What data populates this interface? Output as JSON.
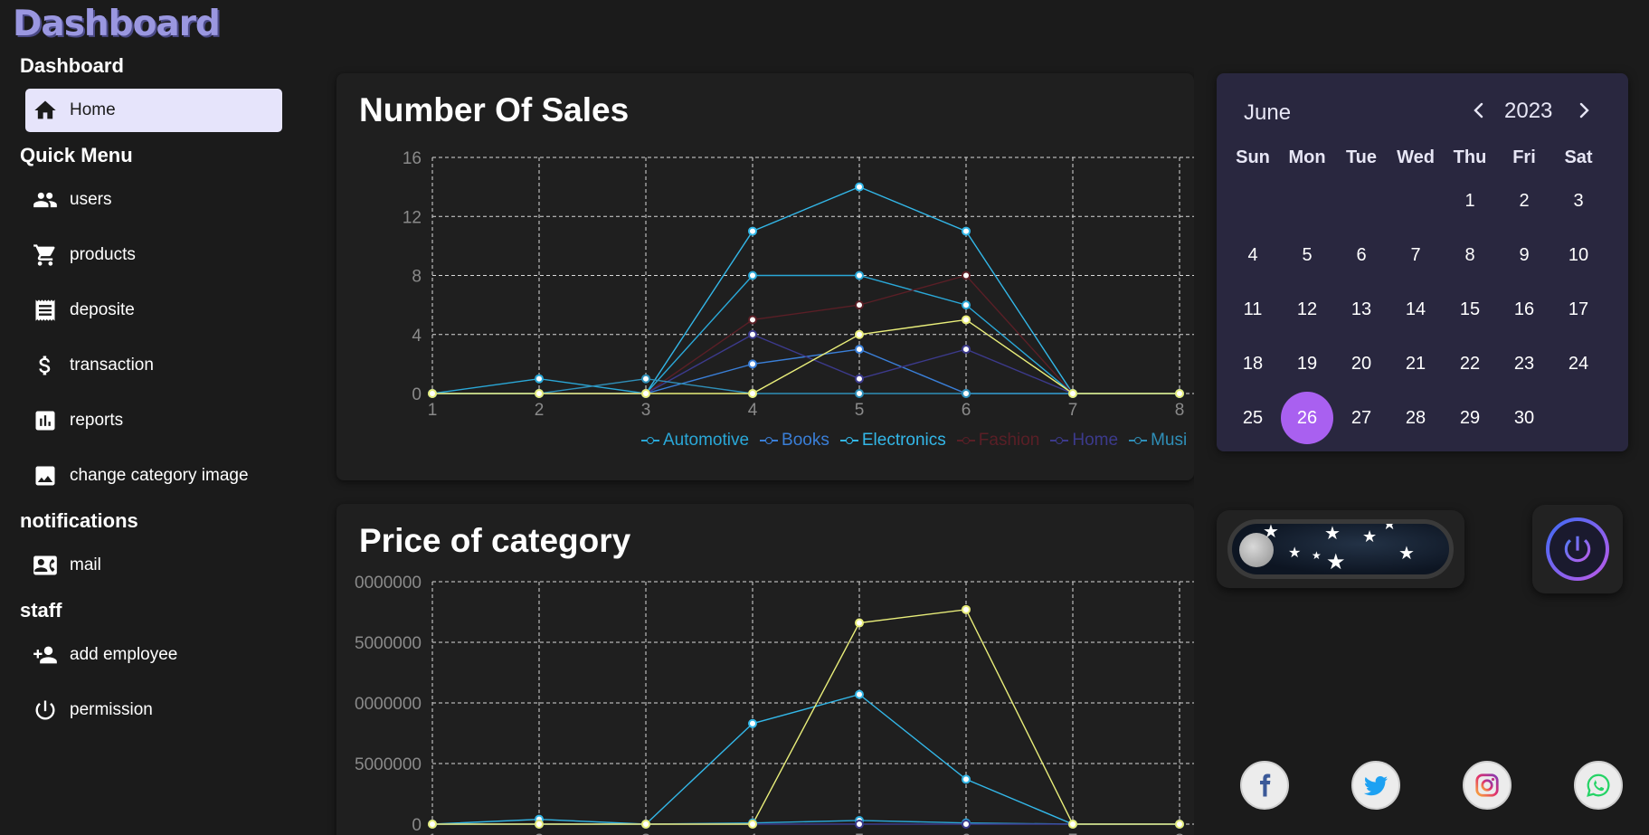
{
  "app": {
    "brand": "Dashboard"
  },
  "header": {
    "settings_icon": "gear-icon",
    "avatar_icon": "user-avatar"
  },
  "sidebar": {
    "sections": [
      {
        "title": "Dashboard",
        "items": [
          {
            "label": "Home",
            "icon": "home-icon",
            "active": true
          }
        ]
      },
      {
        "title": "Quick Menu",
        "items": [
          {
            "label": "users",
            "icon": "users-icon"
          },
          {
            "label": "products",
            "icon": "cart-icon"
          },
          {
            "label": "deposite",
            "icon": "receipt-icon"
          },
          {
            "label": "transaction",
            "icon": "dollar-icon"
          },
          {
            "label": "reports",
            "icon": "bar-chart-icon"
          },
          {
            "label": "change category image",
            "icon": "image-icon"
          }
        ]
      },
      {
        "title": "notifications",
        "items": [
          {
            "label": "mail",
            "icon": "contact-mail-icon"
          }
        ]
      },
      {
        "title": "staff",
        "items": [
          {
            "label": "add employee",
            "icon": "person-add-icon"
          },
          {
            "label": "permission",
            "icon": "power-icon"
          }
        ]
      }
    ]
  },
  "charts": {
    "sales_title": "Number Of Sales",
    "price_title": "Price of category"
  },
  "chart_data": [
    {
      "type": "line",
      "title": "Number Of Sales",
      "x": [
        1,
        2,
        3,
        4,
        5,
        6,
        7,
        8
      ],
      "ylim": [
        0,
        16
      ],
      "yticks": [
        0,
        4,
        8,
        12,
        16
      ],
      "grid": true,
      "legend_position": "bottom",
      "series": [
        {
          "name": "Automotive",
          "color": "#2aa8d8",
          "values": [
            0,
            1,
            0,
            8,
            8,
            6,
            0,
            0
          ]
        },
        {
          "name": "Books",
          "color": "#3a7fd8",
          "values": [
            0,
            0,
            0,
            2,
            3,
            0,
            0,
            0
          ]
        },
        {
          "name": "Electronics",
          "color": "#33b7e8",
          "values": [
            0,
            0,
            0,
            11,
            14,
            11,
            0,
            0
          ]
        },
        {
          "name": "Fashion",
          "color": "#5a1f26",
          "values": [
            0,
            0,
            0,
            5,
            6,
            8,
            0,
            0
          ]
        },
        {
          "name": "Home",
          "color": "#3c3a8c",
          "values": [
            0,
            0,
            0,
            4,
            1,
            3,
            0,
            0
          ]
        },
        {
          "name": "Musi",
          "color": "#2f8fb8",
          "values": [
            0,
            0,
            1,
            0,
            0,
            0,
            0,
            0
          ]
        },
        {
          "color": "#e9ee7a",
          "values": [
            0,
            0,
            0,
            0,
            4,
            5,
            0,
            0
          ]
        }
      ]
    },
    {
      "type": "line",
      "title": "Price of category",
      "x": [
        1,
        2,
        3,
        4,
        5,
        6,
        7,
        8
      ],
      "ylim": [
        0,
        20000000
      ],
      "yticks": [
        0,
        5000000,
        10000000,
        15000000,
        20000000
      ],
      "ytick_labels": [
        "0",
        "5000000",
        "0000000",
        "5000000",
        "0000000"
      ],
      "grid": true,
      "series": [
        {
          "color": "#33b7e8",
          "values": [
            0,
            400000,
            0,
            8300000,
            10700000,
            3700000,
            0,
            0
          ]
        },
        {
          "color": "#2aa8d8",
          "values": [
            0,
            0,
            0,
            100000,
            300000,
            100000,
            0,
            0
          ]
        },
        {
          "color": "#3c3a8c",
          "values": [
            0,
            0,
            0,
            0,
            0,
            0,
            0,
            0
          ]
        },
        {
          "color": "#e9ee7a",
          "values": [
            0,
            0,
            0,
            0,
            16600000,
            17700000,
            0,
            0
          ]
        }
      ]
    }
  ],
  "calendar": {
    "month": "June",
    "year": "2023",
    "today": 26,
    "first_weekday": 4,
    "days_in_month": 30,
    "weekdays": [
      "Sun",
      "Mon",
      "Tue",
      "Wed",
      "Thu",
      "Fri",
      "Sat"
    ],
    "prev_icon": "chevron-left-icon",
    "next_icon": "chevron-right-icon"
  },
  "toggles": {
    "theme_icon": "moon-icon",
    "power_icon": "power-icon"
  },
  "social": [
    {
      "name": "facebook",
      "icon": "facebook-icon",
      "color": "#3b5998"
    },
    {
      "name": "twitter",
      "icon": "twitter-icon",
      "color": "#1da1f2"
    },
    {
      "name": "instagram",
      "icon": "instagram-icon",
      "color": "#d6249f"
    },
    {
      "name": "whatsapp",
      "icon": "whatsapp-icon",
      "color": "#25d366"
    }
  ],
  "colors": {
    "background": "#1b1b1b",
    "card": "#1f1f1f",
    "calendar": "#29273f",
    "accent": "#a960f0",
    "active_nav": "#e6e4fb",
    "brand": "#9a97e0"
  }
}
